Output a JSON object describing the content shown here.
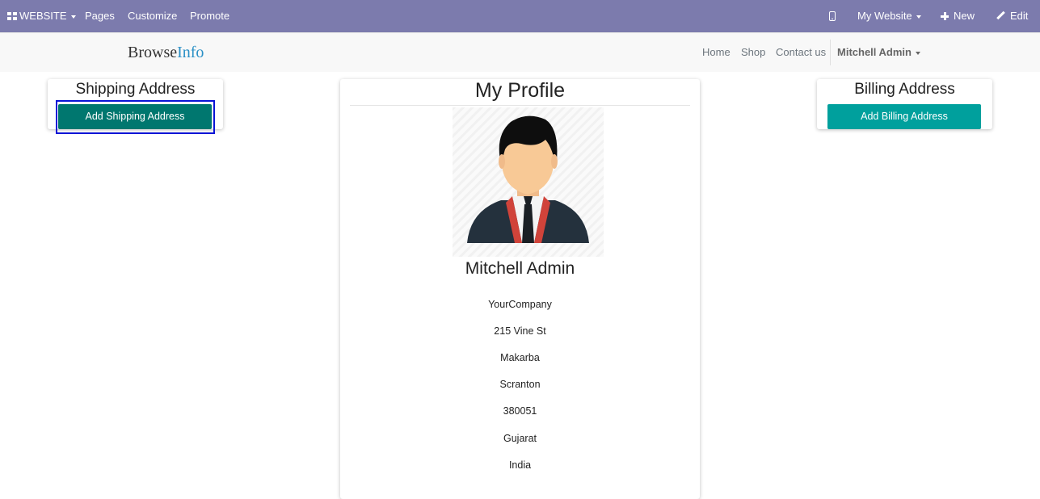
{
  "topbar": {
    "website_label": "WEBSITE",
    "pages_label": "Pages",
    "customize_label": "Customize",
    "promote_label": "Promote",
    "my_website_label": "My Website",
    "new_label": "New",
    "edit_label": "Edit",
    "bg_color": "#7c7bad"
  },
  "header": {
    "logo_part1": "Browse",
    "logo_part2": "Info",
    "nav": {
      "home": "Home",
      "shop": "Shop",
      "contact": "Contact us",
      "user": "Mitchell Admin"
    }
  },
  "shipping": {
    "title": "Shipping Address",
    "button_label": "Add Shipping Address"
  },
  "billing": {
    "title": "Billing Address",
    "button_label": "Add Billing Address"
  },
  "profile": {
    "title": "My Profile",
    "name": "Mitchell Admin",
    "company": "YourCompany",
    "street": "215 Vine St",
    "city": "Makarba",
    "city2": "Scranton",
    "zip": "380051",
    "state": "Gujarat",
    "country": "India"
  },
  "colors": {
    "shipping_button": "#00776f",
    "billing_button": "#00a09d",
    "highlight_border": "#0a14d6"
  }
}
